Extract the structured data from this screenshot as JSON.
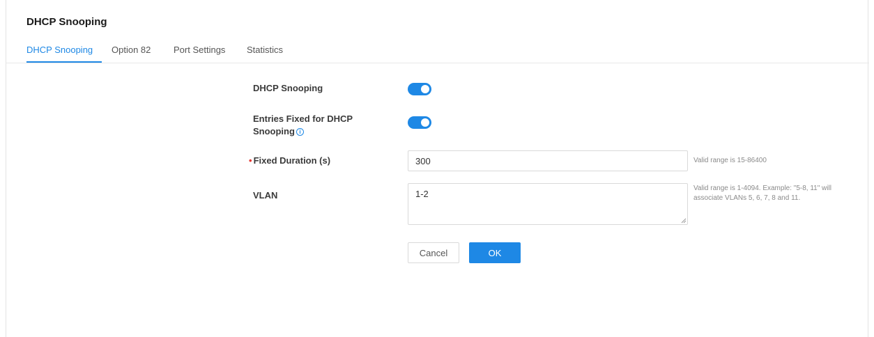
{
  "page": {
    "title": "DHCP Snooping"
  },
  "tabs": [
    {
      "label": "DHCP Snooping",
      "active": true
    },
    {
      "label": "Option 82",
      "active": false
    },
    {
      "label": "Port Settings",
      "active": false
    },
    {
      "label": "Statistics",
      "active": false
    }
  ],
  "form": {
    "dhcp_snooping": {
      "label": "DHCP Snooping",
      "enabled": true
    },
    "entries_fixed": {
      "label": "Entries Fixed for DHCP Snooping",
      "enabled": true,
      "icon": "info-icon"
    },
    "fixed_duration": {
      "required_marker": "•",
      "label": "Fixed Duration (s)",
      "value": "300",
      "hint": "Valid range is 15-86400"
    },
    "vlan": {
      "label": "VLAN",
      "value": "1-2",
      "hint": "Valid range is 1-4094. Example: \"5-8, 11\" will associate VLANs 5, 6, 7, 8 and 11."
    }
  },
  "buttons": {
    "cancel": "Cancel",
    "ok": "OK"
  },
  "colors": {
    "accent": "#1e88e5",
    "required": "#e53935"
  }
}
